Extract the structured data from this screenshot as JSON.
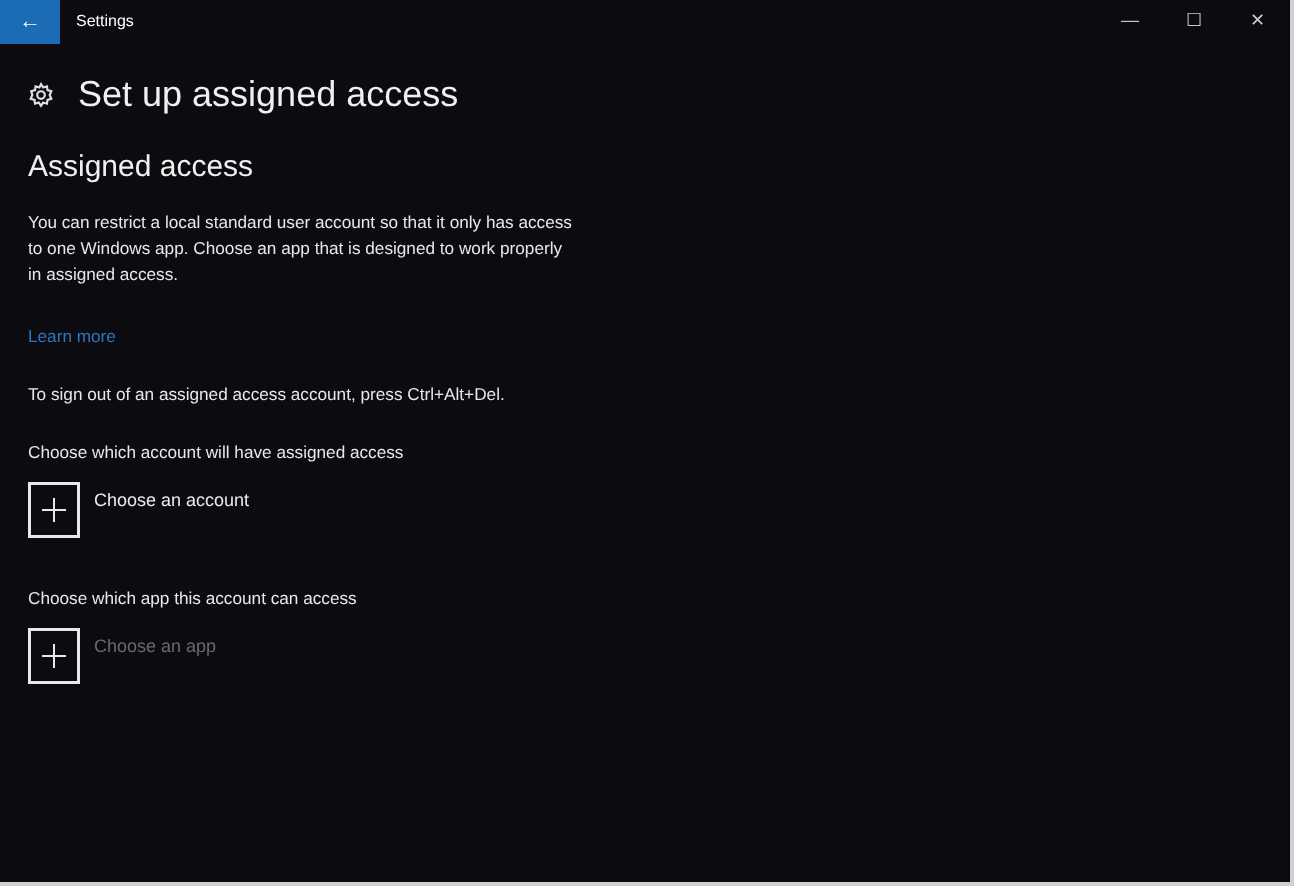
{
  "window": {
    "title": "Settings",
    "back_button": "←",
    "controls": [
      "—",
      "☐",
      "✕"
    ]
  },
  "page_title": "Set up assigned access",
  "section_title": "Assigned access",
  "description": "You can restrict a local standard user account so that it only has access to one Windows app. Choose an app that is designed to work properly in assigned access.",
  "learn_more": "Learn more",
  "sign_out_note": "To sign out of an assigned access account, press Ctrl+Alt+Del.",
  "pickers": [
    {
      "label": "Choose which account will have assigned access",
      "button": "Choose an account",
      "disabled": false
    },
    {
      "label": "Choose which app this account can access",
      "button": "Choose an app",
      "disabled": true
    }
  ]
}
